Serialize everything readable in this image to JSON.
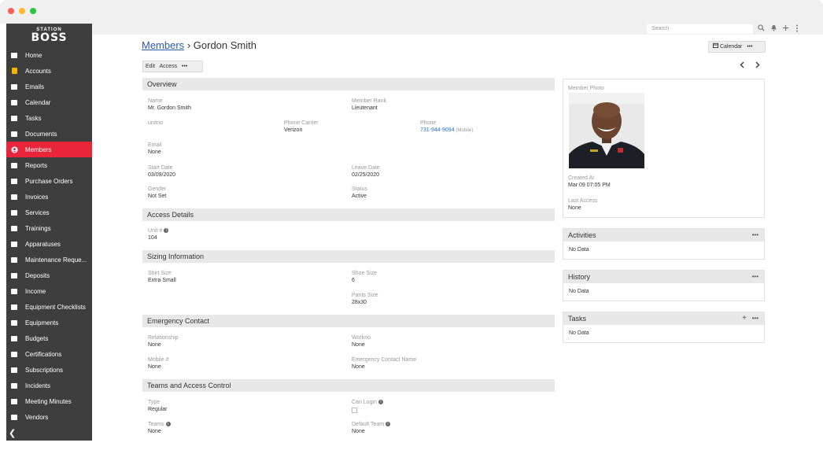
{
  "window": {
    "dot_colors": [
      "#fe5f57",
      "#febc2e",
      "#28c840"
    ]
  },
  "logo": {
    "small": "STATION",
    "big": "BOSS"
  },
  "sidebar": {
    "items": [
      {
        "label": "Home",
        "icon": "home-icon"
      },
      {
        "label": "Accounts",
        "icon": "accounts-icon"
      },
      {
        "label": "Emails",
        "icon": "envelope-icon"
      },
      {
        "label": "Calendar",
        "icon": "calendar-icon"
      },
      {
        "label": "Tasks",
        "icon": "tasks-list-icon"
      },
      {
        "label": "Documents",
        "icon": "document-icon"
      },
      {
        "label": "Members",
        "icon": "user-circle-icon",
        "active": true
      },
      {
        "label": "Reports",
        "icon": "chart-icon"
      },
      {
        "label": "Purchase Orders",
        "icon": "file-icon"
      },
      {
        "label": "Invoices",
        "icon": "invoice-icon"
      },
      {
        "label": "Services",
        "icon": "services-icon"
      },
      {
        "label": "Trainings",
        "icon": "training-icon"
      },
      {
        "label": "Apparatuses",
        "icon": "truck-icon"
      },
      {
        "label": "Maintenance Reque...",
        "icon": "wrench-icon"
      },
      {
        "label": "Deposits",
        "icon": "deposit-icon"
      },
      {
        "label": "Income",
        "icon": "money-icon"
      },
      {
        "label": "Equipment Checklists",
        "icon": "check-icon"
      },
      {
        "label": "Equipments",
        "icon": "tools-icon"
      },
      {
        "label": "Budgets",
        "icon": "budget-icon"
      },
      {
        "label": "Certifications",
        "icon": "certificate-icon"
      },
      {
        "label": "Subscriptions",
        "icon": "subscription-icon"
      },
      {
        "label": "Incidents",
        "icon": "incident-icon"
      },
      {
        "label": "Meeting Minutes",
        "icon": "meeting-icon"
      },
      {
        "label": "Vendors",
        "icon": "vendor-icon"
      }
    ],
    "collapse_glyph": "❮"
  },
  "topbar": {
    "search_placeholder": "Search",
    "icons": [
      "search-icon",
      "bell-icon",
      "plus-icon",
      "more-vertical-icon"
    ]
  },
  "header": {
    "breadcrumb_link": "Members",
    "separator": "›",
    "member_name": "Gordon Smith"
  },
  "toolbar": {
    "edit": "Edit",
    "access": "Access",
    "more": "•••",
    "calendar": "Calendar",
    "calendar_more": "•••"
  },
  "overview": {
    "title": "Overview",
    "name_label": "Name",
    "name": "Mr. Gordon Smith",
    "rank_label": "Member Rank",
    "rank": "Lieutenant",
    "unitno_label": "unitno",
    "carrier_label": "Phone Carrier",
    "carrier": "Verizon",
    "phone_label": "Phone",
    "phone": "731-944-9094",
    "phone_type": "(Mobile)",
    "email_label": "Email",
    "email": "None",
    "start_label": "Start Date",
    "start": "03/09/2020",
    "leave_label": "Leave Date",
    "leave": "02/25/2020",
    "gender_label": "Gender",
    "gender": "Not Set",
    "status_label": "Status",
    "status": "Active"
  },
  "access": {
    "title": "Access Details",
    "unit_label": "Unit #",
    "unit": "104"
  },
  "sizing": {
    "title": "Sizing Information",
    "shirt_label": "Shirt Size",
    "shirt": "Extra Small",
    "shoe_label": "Shoe Size",
    "shoe": "6",
    "pants_label": "Pants Size",
    "pants": "28x30"
  },
  "emergency": {
    "title": "Emergency Contact",
    "relationship_label": "Relationship",
    "relationship": "None",
    "workno_label": "Workno",
    "workno": "None",
    "mobile_label": "Mobile #",
    "mobile": "None",
    "contact_name_label": "Emergency Contact Name",
    "contact_name": "None"
  },
  "teams": {
    "title": "Teams and Access Control",
    "type_label": "Type",
    "type": "Regular",
    "login_label": "Can Login",
    "teams_label": "Teams",
    "teams": "None",
    "default_team_label": "Default Team",
    "default_team": "None"
  },
  "photo_card": {
    "title": "Member Photo",
    "created_label": "Created At",
    "created": "Mar 09 07:05 PM",
    "last_access_label": "Last Access",
    "last_access": "None"
  },
  "activities": {
    "title": "Activities",
    "more": "•••",
    "body": "No Data"
  },
  "history": {
    "title": "History",
    "more": "•••",
    "body": "No Data"
  },
  "tasks": {
    "title": "Tasks",
    "add": "+",
    "more": "•••",
    "body": "No Data"
  },
  "info_glyph": "i"
}
